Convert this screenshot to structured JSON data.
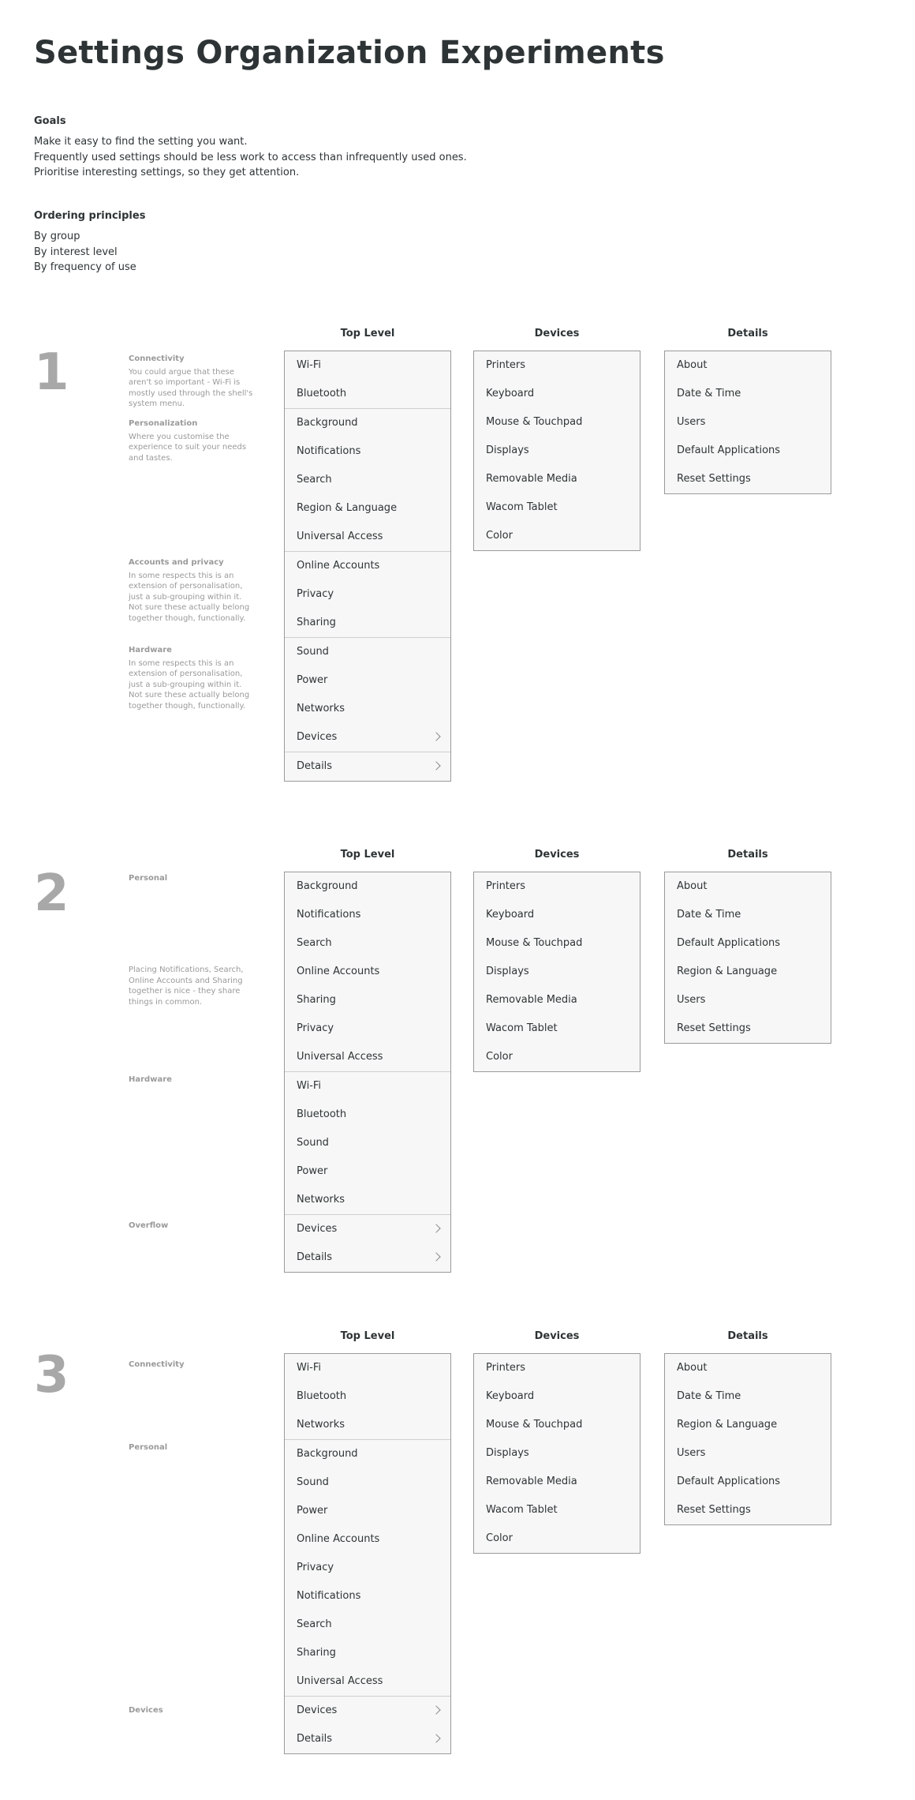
{
  "title": "Settings Organization Experiments",
  "goals": {
    "heading": "Goals",
    "lines": [
      "Make it easy to find the setting you want.",
      "Frequently used settings should be less work to access than infrequently used ones.",
      "Prioritise interesting settings, so they get attention."
    ]
  },
  "principles": {
    "heading": "Ordering principles",
    "lines": [
      "By group",
      "By interest level",
      "By frequency of use"
    ]
  },
  "column_titles": {
    "top": "Top Level",
    "devices": "Devices",
    "details": "Details"
  },
  "experiments": [
    {
      "number": "1",
      "notes": [
        {
          "heading": "Connectivity",
          "text": "You could argue that these aren't so important - Wi-Fi is mostly used through the shell's system menu."
        },
        {
          "heading": "Personalization",
          "text": "Where you customise the experience to suit your needs and tastes."
        },
        {
          "heading": "Accounts and privacy",
          "text": "In some respects this is an extension of personalisation, just a sub-grouping within it. Not sure these actually belong together though, functionally."
        },
        {
          "heading": "Hardware",
          "text": "In some respects this is an extension of personalisation, just a sub-grouping within it. Not sure these actually belong together though, functionally."
        }
      ],
      "top_groups": [
        [
          "Wi-Fi",
          "Bluetooth"
        ],
        [
          "Background",
          "Notifications",
          "Search",
          "Region & Language",
          "Universal Access"
        ],
        [
          "Online Accounts",
          "Privacy",
          "Sharing"
        ],
        [
          "Sound",
          "Power",
          "Networks",
          "Devices"
        ],
        [
          "Details"
        ]
      ],
      "devices": [
        "Printers",
        "Keyboard",
        "Mouse & Touchpad",
        "Displays",
        "Removable Media",
        "Wacom Tablet",
        "Color"
      ],
      "details": [
        "About",
        "Date & Time",
        "Users",
        "Default Applications",
        "Reset Settings"
      ]
    },
    {
      "number": "2",
      "notes": [
        {
          "heading": "Personal",
          "text": ""
        },
        {
          "heading": "",
          "text": "Placing Notifications, Search, Online Accounts and Sharing together is nice - they share things in common."
        },
        {
          "heading": "Hardware",
          "text": ""
        },
        {
          "heading": "Overflow",
          "text": ""
        }
      ],
      "top_groups": [
        [
          "Background",
          "Notifications",
          "Search",
          "Online Accounts",
          "Sharing",
          "Privacy",
          "Universal Access"
        ],
        [
          "Wi-Fi",
          "Bluetooth",
          "Sound",
          "Power",
          "Networks"
        ],
        [
          "Devices",
          "Details"
        ]
      ],
      "devices": [
        "Printers",
        "Keyboard",
        "Mouse & Touchpad",
        "Displays",
        "Removable Media",
        "Wacom Tablet",
        "Color"
      ],
      "details": [
        "About",
        "Date & Time",
        "Default Applications",
        "Region & Language",
        "Users",
        "Reset Settings"
      ]
    },
    {
      "number": "3",
      "notes": [
        {
          "heading": "Connectivity",
          "text": ""
        },
        {
          "heading": "Personal",
          "text": ""
        },
        {
          "heading": "Devices",
          "text": ""
        }
      ],
      "top_groups": [
        [
          "Wi-Fi",
          "Bluetooth",
          "Networks"
        ],
        [
          "Background",
          "Sound",
          "Power",
          "Online Accounts",
          "Privacy",
          "Notifications",
          "Search",
          "Sharing",
          "Universal Access"
        ],
        [
          "Devices",
          "Details"
        ]
      ],
      "devices": [
        "Printers",
        "Keyboard",
        "Mouse & Touchpad",
        "Displays",
        "Removable Media",
        "Wacom Tablet",
        "Color"
      ],
      "details": [
        "About",
        "Date & Time",
        "Region & Language",
        "Users",
        "Default Applications",
        "Reset Settings"
      ]
    }
  ],
  "chevron_icon": "chevron-right-icon"
}
